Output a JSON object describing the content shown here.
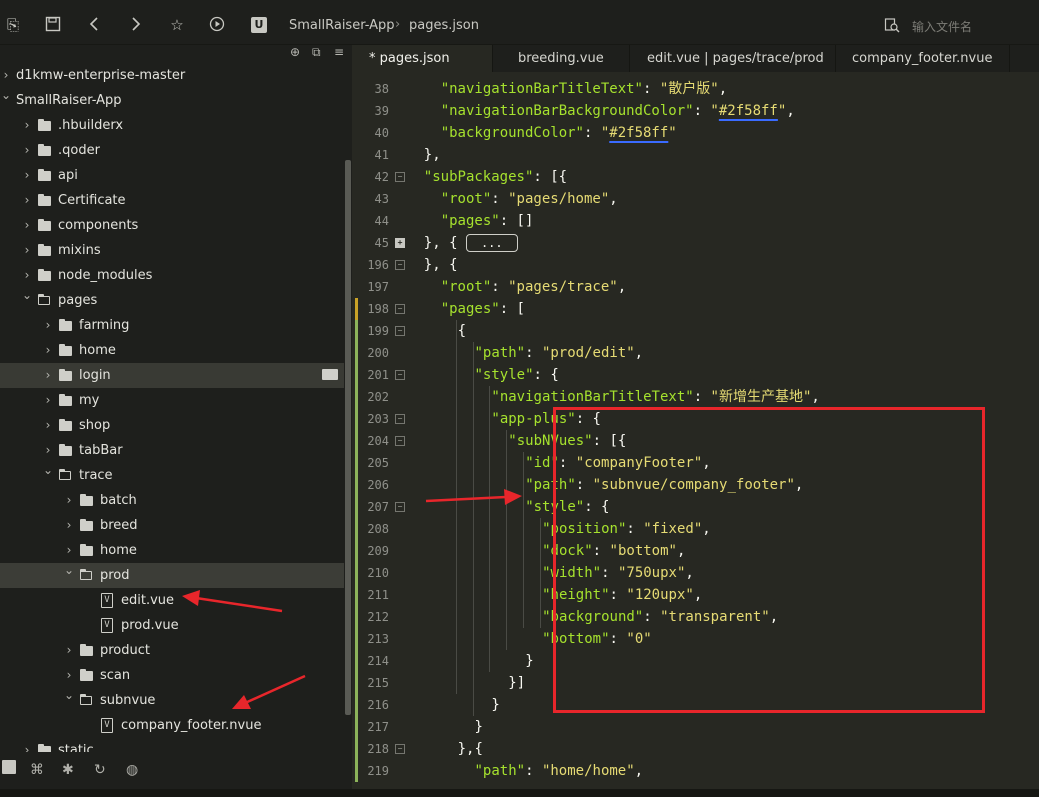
{
  "toolbar": {
    "breadcrumb": [
      "SmallRaiser-App",
      "pages.json"
    ],
    "search_placeholder": "输入文件名"
  },
  "sidebar": {
    "tree": [
      {
        "label": "d1kmw-enterprise-master",
        "depth": 0,
        "kind": "folder",
        "expanded": false
      },
      {
        "label": "SmallRaiser-App",
        "depth": 0,
        "kind": "folder",
        "expanded": true
      },
      {
        "label": ".hbuilderx",
        "depth": 1,
        "kind": "folder",
        "expanded": false
      },
      {
        "label": ".qoder",
        "depth": 1,
        "kind": "folder",
        "expanded": false
      },
      {
        "label": "api",
        "depth": 1,
        "kind": "folder",
        "expanded": false
      },
      {
        "label": "Certificate",
        "depth": 1,
        "kind": "folder",
        "expanded": false
      },
      {
        "label": "components",
        "depth": 1,
        "kind": "folder",
        "expanded": false
      },
      {
        "label": "mixins",
        "depth": 1,
        "kind": "folder",
        "expanded": false
      },
      {
        "label": "node_modules",
        "depth": 1,
        "kind": "folder",
        "expanded": false
      },
      {
        "label": "pages",
        "depth": 1,
        "kind": "folder",
        "expanded": true
      },
      {
        "label": "farming",
        "depth": 2,
        "kind": "folder",
        "expanded": false
      },
      {
        "label": "home",
        "depth": 2,
        "kind": "folder",
        "expanded": false
      },
      {
        "label": "login",
        "depth": 2,
        "kind": "folder",
        "expanded": false,
        "state": "hover"
      },
      {
        "label": "my",
        "depth": 2,
        "kind": "folder",
        "expanded": false
      },
      {
        "label": "shop",
        "depth": 2,
        "kind": "folder",
        "expanded": false
      },
      {
        "label": "tabBar",
        "depth": 2,
        "kind": "folder",
        "expanded": false
      },
      {
        "label": "trace",
        "depth": 2,
        "kind": "folder",
        "expanded": true
      },
      {
        "label": "batch",
        "depth": 3,
        "kind": "folder",
        "expanded": false
      },
      {
        "label": "breed",
        "depth": 3,
        "kind": "folder",
        "expanded": false
      },
      {
        "label": "home",
        "depth": 3,
        "kind": "folder",
        "expanded": false
      },
      {
        "label": "prod",
        "depth": 3,
        "kind": "folder",
        "expanded": true,
        "state": "selected"
      },
      {
        "label": "edit.vue",
        "depth": 4,
        "kind": "file"
      },
      {
        "label": "prod.vue",
        "depth": 4,
        "kind": "file"
      },
      {
        "label": "product",
        "depth": 3,
        "kind": "folder",
        "expanded": false
      },
      {
        "label": "scan",
        "depth": 3,
        "kind": "folder",
        "expanded": false
      },
      {
        "label": "subnvue",
        "depth": 3,
        "kind": "folder",
        "expanded": true
      },
      {
        "label": "company_footer.nvue",
        "depth": 4,
        "kind": "file"
      },
      {
        "label": "static",
        "depth": 1,
        "kind": "folder",
        "expanded": false
      }
    ]
  },
  "tabs": [
    {
      "label": "* pages.json",
      "active": true
    },
    {
      "label": "breeding.vue",
      "active": false
    },
    {
      "label": "edit.vue | pages/trace/prod",
      "active": false
    },
    {
      "label": "company_footer.nvue",
      "active": false
    }
  ],
  "editor": {
    "lines": [
      {
        "n": "38",
        "indent": 6,
        "tokens": [
          [
            "k",
            "\"navigationBarTitleText\""
          ],
          [
            "p",
            ": "
          ],
          [
            "s",
            "\"散户版\""
          ],
          [
            "p",
            ","
          ]
        ]
      },
      {
        "n": "39",
        "indent": 6,
        "tokens": [
          [
            "k",
            "\"navigationBarBackgroundColor\""
          ],
          [
            "p",
            ": "
          ],
          [
            "s",
            "\""
          ],
          [
            "su",
            "#2f58ff"
          ],
          [
            "s",
            "\""
          ],
          [
            "p",
            ","
          ]
        ]
      },
      {
        "n": "40",
        "indent": 6,
        "tokens": [
          [
            "k",
            "\"backgroundColor\""
          ],
          [
            "p",
            ": "
          ],
          [
            "s",
            "\""
          ],
          [
            "su",
            "#2f58ff"
          ],
          [
            "s",
            "\""
          ]
        ]
      },
      {
        "n": "41",
        "indent": 4,
        "tokens": [
          [
            "p",
            "},"
          ]
        ]
      },
      {
        "n": "42",
        "indent": 4,
        "fold": "-",
        "tokens": [
          [
            "k",
            "\"subPackages\""
          ],
          [
            "p",
            ": [{"
          ]
        ]
      },
      {
        "n": "43",
        "indent": 6,
        "tokens": [
          [
            "k",
            "\"root\""
          ],
          [
            "p",
            ": "
          ],
          [
            "s",
            "\"pages/home\""
          ],
          [
            "p",
            ","
          ]
        ]
      },
      {
        "n": "44",
        "indent": 6,
        "tokens": [
          [
            "k",
            "\"pages\""
          ],
          [
            "p",
            ": []"
          ]
        ]
      },
      {
        "n": "45",
        "indent": 4,
        "fold": "+",
        "collapsed": "...",
        "tokens": [
          [
            "p",
            "}, { "
          ]
        ]
      },
      {
        "n": "196",
        "indent": 4,
        "fold": "-",
        "tokens": [
          [
            "p",
            "}, {"
          ]
        ]
      },
      {
        "n": "197",
        "indent": 6,
        "tokens": [
          [
            "k",
            "\"root\""
          ],
          [
            "p",
            ": "
          ],
          [
            "s",
            "\"pages/trace\""
          ],
          [
            "p",
            ","
          ]
        ]
      },
      {
        "n": "198",
        "indent": 6,
        "fold": "-",
        "tokens": [
          [
            "k",
            "\"pages\""
          ],
          [
            "p",
            ": ["
          ]
        ]
      },
      {
        "n": "199",
        "indent": 8,
        "fold": "-",
        "tokens": [
          [
            "p",
            "{"
          ]
        ]
      },
      {
        "n": "200",
        "indent": 10,
        "tokens": [
          [
            "k",
            "\"path\""
          ],
          [
            "p",
            ": "
          ],
          [
            "s",
            "\"prod/edit\""
          ],
          [
            "p",
            ","
          ]
        ]
      },
      {
        "n": "201",
        "indent": 10,
        "fold": "-",
        "tokens": [
          [
            "k",
            "\"style\""
          ],
          [
            "p",
            ": {"
          ]
        ]
      },
      {
        "n": "202",
        "indent": 12,
        "tokens": [
          [
            "k",
            "\"navigationBarTitleText\""
          ],
          [
            "p",
            ": "
          ],
          [
            "s",
            "\"新增生产基地\""
          ],
          [
            "p",
            ","
          ]
        ]
      },
      {
        "n": "203",
        "indent": 12,
        "fold": "-",
        "tokens": [
          [
            "k",
            "\"app-plus\""
          ],
          [
            "p",
            ": {"
          ]
        ]
      },
      {
        "n": "204",
        "indent": 14,
        "fold": "-",
        "tokens": [
          [
            "k",
            "\"subNVues\""
          ],
          [
            "p",
            ": [{"
          ]
        ]
      },
      {
        "n": "205",
        "indent": 16,
        "tokens": [
          [
            "k",
            "\"id\""
          ],
          [
            "p",
            ": "
          ],
          [
            "s",
            "\"companyFooter\""
          ],
          [
            "p",
            ","
          ]
        ]
      },
      {
        "n": "206",
        "indent": 16,
        "tokens": [
          [
            "k",
            "\"path\""
          ],
          [
            "p",
            ": "
          ],
          [
            "s",
            "\"subnvue/company_footer\""
          ],
          [
            "p",
            ","
          ]
        ]
      },
      {
        "n": "207",
        "indent": 16,
        "fold": "-",
        "tokens": [
          [
            "k",
            "\"style\""
          ],
          [
            "p",
            ": {"
          ]
        ]
      },
      {
        "n": "208",
        "indent": 18,
        "tokens": [
          [
            "k",
            "\"position\""
          ],
          [
            "p",
            ": "
          ],
          [
            "s",
            "\"fixed\""
          ],
          [
            "p",
            ","
          ]
        ]
      },
      {
        "n": "209",
        "indent": 18,
        "tokens": [
          [
            "k",
            "\"dock\""
          ],
          [
            "p",
            ": "
          ],
          [
            "s",
            "\"bottom\""
          ],
          [
            "p",
            ","
          ]
        ]
      },
      {
        "n": "210",
        "indent": 18,
        "tokens": [
          [
            "k",
            "\"width\""
          ],
          [
            "p",
            ": "
          ],
          [
            "s",
            "\"750upx\""
          ],
          [
            "p",
            ","
          ]
        ]
      },
      {
        "n": "211",
        "indent": 18,
        "tokens": [
          [
            "k",
            "\"height\""
          ],
          [
            "p",
            ": "
          ],
          [
            "s",
            "\"120upx\""
          ],
          [
            "p",
            ","
          ]
        ]
      },
      {
        "n": "212",
        "indent": 18,
        "tokens": [
          [
            "k",
            "\"background\""
          ],
          [
            "p",
            ": "
          ],
          [
            "s",
            "\"transparent\""
          ],
          [
            "p",
            ","
          ]
        ]
      },
      {
        "n": "213",
        "indent": 18,
        "tokens": [
          [
            "k",
            "\"bottom\""
          ],
          [
            "p",
            ": "
          ],
          [
            "s",
            "\"0\""
          ]
        ]
      },
      {
        "n": "214",
        "indent": 16,
        "tokens": [
          [
            "p",
            "}"
          ]
        ]
      },
      {
        "n": "215",
        "indent": 14,
        "tokens": [
          [
            "p",
            "}]"
          ]
        ]
      },
      {
        "n": "216",
        "indent": 12,
        "tokens": [
          [
            "p",
            "}"
          ]
        ]
      },
      {
        "n": "217",
        "indent": 10,
        "tokens": [
          [
            "p",
            "}"
          ]
        ]
      },
      {
        "n": "218",
        "indent": 8,
        "fold": "-",
        "tokens": [
          [
            "p",
            "},{"
          ]
        ]
      },
      {
        "n": "219",
        "indent": 10,
        "tokens": [
          [
            "k",
            "\"path\""
          ],
          [
            "p",
            ": "
          ],
          [
            "s",
            "\"home/home\""
          ],
          [
            "p",
            ","
          ]
        ]
      }
    ]
  },
  "colors": {
    "annotation_red": "#e8262b",
    "json_key": "#a6e22e",
    "json_string": "#e6db74",
    "editor_bg": "#272822",
    "sidebar_bg": "#1e1f1c"
  },
  "icons": {
    "toolbar": [
      "new-file-icon",
      "save-icon",
      "back-icon",
      "forward-icon",
      "star-icon",
      "run-icon",
      "project-icon",
      "search-icon"
    ],
    "sidebar_bottom": [
      "explorer-icon",
      "preview-icon",
      "debug-icon",
      "refresh-icon",
      "globe-icon"
    ]
  }
}
